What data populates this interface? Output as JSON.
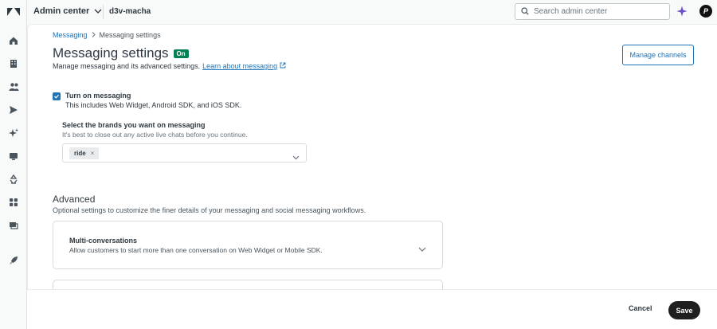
{
  "colors": {
    "accent": "#1f73b7",
    "success": "#038153",
    "text": "#2f3941",
    "sidebar_bg": "#f8f9f9"
  },
  "sidebar": {
    "logo_icon": "zendesk-logo-icon",
    "items": [
      {
        "icon": "home-icon"
      },
      {
        "icon": "building-icon"
      },
      {
        "icon": "people-icon"
      },
      {
        "icon": "send-icon"
      },
      {
        "icon": "sparkle-icon"
      },
      {
        "icon": "monitor-icon"
      },
      {
        "icon": "recycle-icon"
      },
      {
        "icon": "apps-grid-icon"
      },
      {
        "icon": "workspace-icon"
      },
      {
        "icon": "rocket-icon"
      }
    ]
  },
  "topbar": {
    "product_label": "Admin center",
    "account_name": "d3v-macha",
    "search_placeholder": "Search admin center",
    "avatar_initial": "P"
  },
  "breadcrumb": {
    "parent": "Messaging",
    "current": "Messaging settings"
  },
  "page": {
    "title": "Messaging settings",
    "status_badge": "On",
    "subtitle": "Manage messaging and its advanced settings.",
    "learn_link": "Learn about messaging",
    "manage_channels": "Manage channels"
  },
  "messaging_toggle": {
    "label": "Turn on messaging",
    "checked": true,
    "hint": "This includes Web Widget, Android SDK, and iOS SDK."
  },
  "brands": {
    "label": "Select the brands you want on messaging",
    "hint": "It's best to close out any active live chats before you continue.",
    "selected": [
      "ride"
    ],
    "remove_glyph": "×"
  },
  "advanced": {
    "title": "Advanced",
    "hint": "Optional settings to customize the finer details of your messaging and social messaging workflows.",
    "cards": [
      {
        "title": "Multi-conversations",
        "desc": "Allow customers to start more than one conversation on Web Widget or Mobile SDK."
      }
    ]
  },
  "footer": {
    "cancel": "Cancel",
    "save": "Save"
  }
}
